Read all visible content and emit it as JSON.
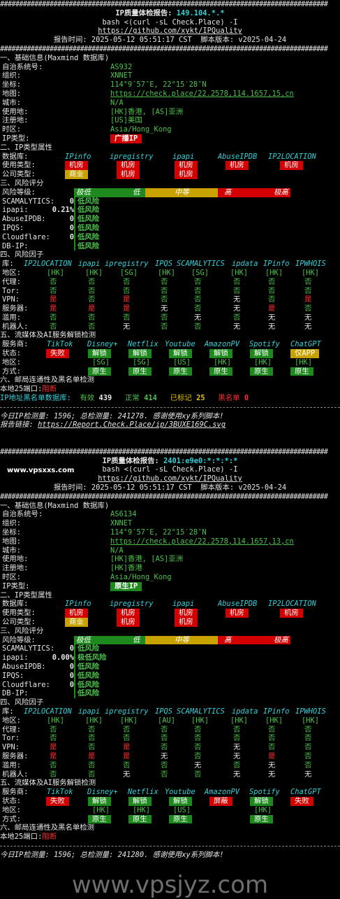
{
  "reports": [
    {
      "title": "IP质量体检报告: ",
      "ip": "149.104.*.*",
      "cmd": "bash <(curl -sL Check.Place) -I",
      "repo": "https://github.com/xykt/IPQuality",
      "meta": "报告时间: 2025-05-12 05:51:17 CST  脚本版本: v2025-04-24",
      "sec1": "一、基础信息(Maxmind 数据库)",
      "basic": {
        "asn_label": "自治系统号:",
        "asn": "AS932",
        "org_label": "组织:",
        "org": "XNNET",
        "coord_label": "坐标:",
        "coord": "114°9′57″E, 22°15′28″N",
        "map_label": "地图:",
        "map": "https://check.place/22.2578,114.1657,15,cn",
        "city_label": "城市:",
        "city": "N/A",
        "use_label": "使用地:",
        "use": "[HK]香港, [AS]亚洲",
        "reg_label": "注册地:",
        "reg": "[US]美国",
        "tz_label": "时区:",
        "tz": "Asia/Hong_Kong",
        "type_label": "IP类型:",
        "type": "广播IP"
      },
      "sec2": "二、IP类型属性",
      "db_label": "数据库:",
      "dbs": [
        "IPinfo",
        "ipregistry",
        "ipapi",
        "AbuseIPDB",
        "IP2LOCATION"
      ],
      "usetype_label": "使用类型:",
      "usetype": [
        "机房",
        "机房",
        "机房",
        "机房",
        "机房"
      ],
      "comptype_label": "公司类型:",
      "comptype": [
        "商业",
        "机房",
        "机房"
      ],
      "sec3": "三、风险评分",
      "risk_label": "风险等级:",
      "risk_scale": [
        "极低",
        "低",
        "中等",
        "高",
        "极高"
      ],
      "scores": [
        {
          "label": "SCAMALYTICS:",
          "val": "0",
          "text": "低风险"
        },
        {
          "label": "ipapi:",
          "val": "0.21%",
          "text": "低风险"
        },
        {
          "label": "AbuseIPDB:",
          "val": "0",
          "text": "低风险"
        },
        {
          "label": "IPQS:",
          "val": "0",
          "text": "低风险"
        },
        {
          "label": "Cloudflare:",
          "val": "0",
          "text": "低风险"
        },
        {
          "label": "DB-IP:",
          "val": "",
          "text": "低风险"
        }
      ],
      "sec4": "四、风险因子",
      "lib_label": "库:",
      "libs": [
        "IP2LOCATION",
        "ipapi",
        "ipregistry",
        "IPQS",
        "SCAMALYTICS",
        "ipdata",
        "IPinfo",
        "IPWHOIS"
      ],
      "factors": [
        {
          "label": "地区:",
          "vals": [
            "[HK]",
            "[HK]",
            "[SG]",
            "[HK]",
            "[SG]",
            "[HK]",
            "[HK]",
            "[HK]"
          ]
        },
        {
          "label": "代理:",
          "vals": [
            "否",
            "否",
            "否",
            "否",
            "否",
            "否",
            "否",
            "否"
          ]
        },
        {
          "label": "Tor:",
          "vals": [
            "否",
            "否",
            "否",
            "否",
            "否",
            "否",
            "否",
            "否"
          ]
        },
        {
          "label": "VPN:",
          "vals": [
            "是",
            "否",
            "是",
            "否",
            "否",
            "无",
            "否",
            "是"
          ]
        },
        {
          "label": "服务器:",
          "vals": [
            "是",
            "是",
            "是",
            "无",
            "否",
            "无",
            "是",
            "否"
          ]
        },
        {
          "label": "滥用:",
          "vals": [
            "否",
            "否",
            "否",
            "否",
            "无",
            "否",
            "无",
            "无"
          ]
        },
        {
          "label": "机器人:",
          "vals": [
            "否",
            "否",
            "无",
            "否",
            "否",
            "无",
            "无",
            "无"
          ]
        }
      ],
      "sec5": "五、流媒体及AI服务解锁检测",
      "svc_label": "服务商:",
      "services": [
        "TikTok",
        "Disney+",
        "Netflix",
        "Youtube",
        "AmazonPV",
        "Spotify",
        "ChatGPT"
      ],
      "status_label": "状态:",
      "status": [
        {
          "t": "失败",
          "c": "red"
        },
        {
          "t": "解锁",
          "c": "green"
        },
        {
          "t": "解锁",
          "c": "green"
        },
        {
          "t": "解锁",
          "c": "green"
        },
        {
          "t": "解锁",
          "c": "green"
        },
        {
          "t": "解锁",
          "c": "green"
        },
        {
          "t": "仅APP",
          "c": "yellow"
        }
      ],
      "region_label": "地区:",
      "regions": [
        "",
        "[SG]",
        "[SG]",
        "[US]",
        "[HK]",
        "[HK]",
        "[HK]"
      ],
      "mode_label": "方式:",
      "modes": [
        "",
        "原生",
        "原生",
        "原生",
        "原生",
        "原生",
        "原生"
      ],
      "sec6": "六、邮局连通性及黑名单检测",
      "port_label": "本地25端口:",
      "port": "阻断",
      "bl_label": "IP地址黑名单数据库:",
      "bl": {
        "valid_l": "有效",
        "valid": "439",
        "ok_l": "正常",
        "ok": "414",
        "mark_l": "已标记",
        "mark": "25",
        "black_l": "黑名单",
        "black": "0"
      },
      "footer1": "今日IP检测量: 1596; 总检测量: 241278. 感谢使用xy系列脚本!",
      "footer2_l": "报告链接: ",
      "footer2": "https://Report.Check.Place/ip/3BUXE169C.svg"
    },
    {
      "title": "IP质量体检报告: ",
      "ip": "2401:e9e0:*:*:*:*",
      "cmd": "bash <(curl -sL Check.Place) -I",
      "repo": "https://github.com/xykt/IPQuality",
      "meta": "报告时间: 2025-05-12 05:51:17 CST  脚本版本: v2025-04-24",
      "sec1": "一、基础信息(Maxmind 数据库)",
      "basic": {
        "asn_label": "自治系统号:",
        "asn": "AS6134",
        "org_label": "组织:",
        "org": "XNNET",
        "coord_label": "坐标:",
        "coord": "114°9′57″E, 22°15′28″N",
        "map_label": "地图:",
        "map": "https://check.place/22.2578,114.1657,13,cn",
        "city_label": "城市:",
        "city": "N/A",
        "use_label": "使用地:",
        "use": "[HK]香港, [AS]亚洲",
        "reg_label": "注册地:",
        "reg": "[HK]香港",
        "tz_label": "时区:",
        "tz": "Asia/Hong_Kong",
        "type_label": "IP类型:",
        "type": "原生IP"
      },
      "sec2": "二、IP类型属性",
      "db_label": "数据库:",
      "dbs": [
        "IPinfo",
        "ipregistry",
        "ipapi",
        "AbuseIPDB",
        "IP2LOCATION"
      ],
      "usetype_label": "使用类型:",
      "usetype": [
        "机房",
        "机房",
        "机房",
        "机房",
        "机房"
      ],
      "comptype_label": "公司类型:",
      "comptype": [
        "商业",
        "机房",
        "机房"
      ],
      "sec3": "三、风险评分",
      "risk_label": "风险等级:",
      "risk_scale": [
        "极低",
        "低",
        "中等",
        "高",
        "极高"
      ],
      "scores": [
        {
          "label": "SCAMALYTICS:",
          "val": "0",
          "text": "低风险"
        },
        {
          "label": "ipapi:",
          "val": "0.00%",
          "text": "极低风险"
        },
        {
          "label": "AbuseIPDB:",
          "val": "0",
          "text": "低风险"
        },
        {
          "label": "IPQS:",
          "val": "0",
          "text": "低风险"
        },
        {
          "label": "Cloudflare:",
          "val": "0",
          "text": "低风险"
        },
        {
          "label": "DB-IP:",
          "val": "",
          "text": "低风险"
        }
      ],
      "sec4": "四、风险因子",
      "lib_label": "库:",
      "libs": [
        "IP2LOCATION",
        "ipapi",
        "ipregistry",
        "IPQS",
        "SCAMALYTICS",
        "ipdata",
        "IPinfo",
        "IPWHOIS"
      ],
      "factors": [
        {
          "label": "地区:",
          "vals": [
            "[HK]",
            "[HK]",
            "[HK]",
            "[AU]",
            "[HK]",
            "[HK]",
            "[HK]",
            "[HK]"
          ]
        },
        {
          "label": "代理:",
          "vals": [
            "否",
            "否",
            "否",
            "否",
            "否",
            "否",
            "否",
            "否"
          ]
        },
        {
          "label": "Tor:",
          "vals": [
            "否",
            "否",
            "否",
            "否",
            "否",
            "否",
            "否",
            "否"
          ]
        },
        {
          "label": "VPN:",
          "vals": [
            "是",
            "否",
            "是",
            "否",
            "否",
            "无",
            "否",
            "否"
          ]
        },
        {
          "label": "服务器:",
          "vals": [
            "是",
            "是",
            "是",
            "无",
            "否",
            "无",
            "是",
            "否"
          ]
        },
        {
          "label": "滥用:",
          "vals": [
            "否",
            "否",
            "否",
            "否",
            "无",
            "否",
            "无",
            "否"
          ]
        },
        {
          "label": "机器人:",
          "vals": [
            "否",
            "否",
            "无",
            "否",
            "否",
            "无",
            "无",
            "无"
          ]
        }
      ],
      "sec5": "五、流媒体及AI服务解锁检测",
      "svc_label": "服务商:",
      "services": [
        "TikTok",
        "Disney+",
        "Netflix",
        "Youtube",
        "AmazonPV",
        "Spotify",
        "ChatGPT"
      ],
      "status_label": "状态:",
      "status": [
        {
          "t": "失败",
          "c": "red"
        },
        {
          "t": "解锁",
          "c": "green"
        },
        {
          "t": "解锁",
          "c": "green"
        },
        {
          "t": "解锁",
          "c": "green"
        },
        {
          "t": "屏蔽",
          "c": "red"
        },
        {
          "t": "解锁",
          "c": "green"
        },
        {
          "t": "失败",
          "c": "red"
        }
      ],
      "region_label": "地区:",
      "regions": [
        "",
        "[HK]",
        "[HK]",
        "[US]",
        "",
        "[HK]",
        ""
      ],
      "mode_label": "方式:",
      "modes": [
        "",
        "原生",
        "原生",
        "原生",
        "",
        "原生",
        ""
      ],
      "sec6": "六、邮局连通性及黑名单检测",
      "port_label": "本地25端口:",
      "port": "阻断",
      "footer1": "今日IP检测量: 1596; 总检测量: 241280. 感谢使用xy系列脚本!"
    }
  ],
  "watermark_top": "www.vpsxxs.com",
  "watermark_bottom": "www.vpsjyz.com"
}
